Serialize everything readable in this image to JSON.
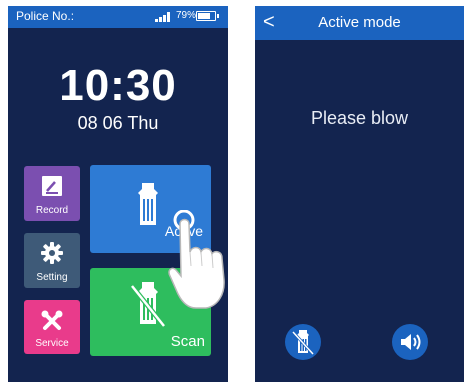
{
  "left_screen": {
    "status": {
      "label": "Police No.:",
      "battery": "79%",
      "battery_level": 0.79
    },
    "clock": {
      "time": "10:30",
      "date": "08 06 Thu"
    },
    "menu": {
      "record": "Record",
      "setting": "Setting",
      "service": "Service",
      "active": "Active",
      "scan": "Scan"
    },
    "colors": {
      "record": "#7b4fb0",
      "setting": "#3e5a78",
      "service": "#e93b8b",
      "active": "#2e7bd4",
      "scan": "#2ebd5e"
    }
  },
  "right_screen": {
    "header": {
      "back": "<",
      "title": "Active mode"
    },
    "prompt": "Please blow",
    "icons": [
      "mouthpiece-off-icon",
      "speaker-icon"
    ]
  }
}
